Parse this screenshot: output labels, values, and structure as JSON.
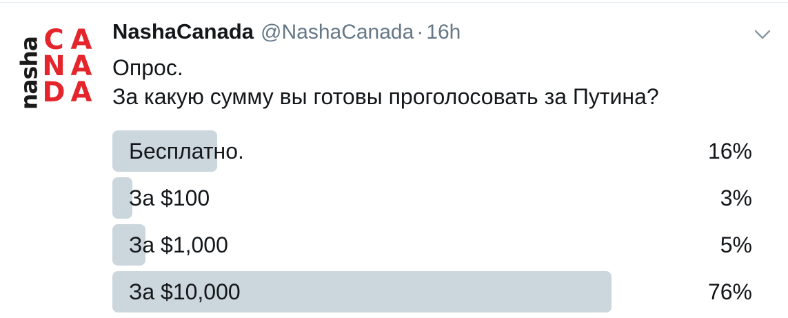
{
  "tweet": {
    "display_name": "NashaCanada",
    "handle": "@NashaCanada",
    "separator": "·",
    "timestamp": "16h",
    "text_lines": [
      "Опрос.",
      "За какую сумму вы готовы проголосовать за Путина?"
    ]
  },
  "avatar": {
    "side_text": "nasha",
    "letters": [
      "C",
      "A",
      "N",
      "A",
      "D",
      "A"
    ],
    "brand_color": "#e4252b"
  },
  "poll": {
    "bar_color": "#ccd6dd",
    "options": [
      {
        "label": "Бесплатно.",
        "percent_label": "16%",
        "fraction": 0.16
      },
      {
        "label": "За $100",
        "percent_label": "3%",
        "fraction": 0.03
      },
      {
        "label": "За $1,000",
        "percent_label": "5%",
        "fraction": 0.05
      },
      {
        "label": "За $10,000",
        "percent_label": "76%",
        "fraction": 0.76
      }
    ]
  },
  "icons": {
    "caret": "chevron-down-icon"
  }
}
